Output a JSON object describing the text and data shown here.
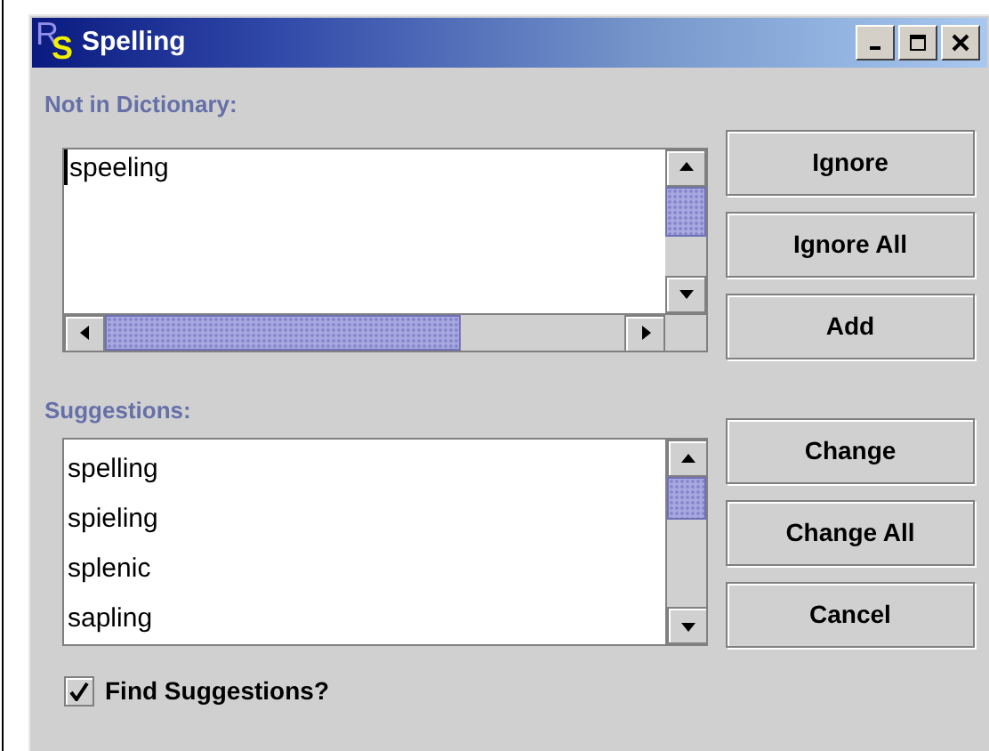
{
  "window": {
    "title": "Spelling",
    "logo": [
      "R",
      "S"
    ]
  },
  "not_in_dictionary": {
    "label": "Not in Dictionary:",
    "value": "speeling"
  },
  "suggestions": {
    "label": "Suggestions:",
    "items": [
      {
        "text": "spelling",
        "selected": false
      },
      {
        "text": "spieling",
        "selected": false
      },
      {
        "text": "splenic",
        "selected": false
      },
      {
        "text": "sapling",
        "selected": false
      }
    ]
  },
  "top_buttons": [
    "Ignore",
    "Ignore All",
    "Add"
  ],
  "bottom_buttons": [
    "Change",
    "Change All",
    "Cancel"
  ],
  "find_suggestions": {
    "label": "Find Suggestions?",
    "checked": true
  }
}
